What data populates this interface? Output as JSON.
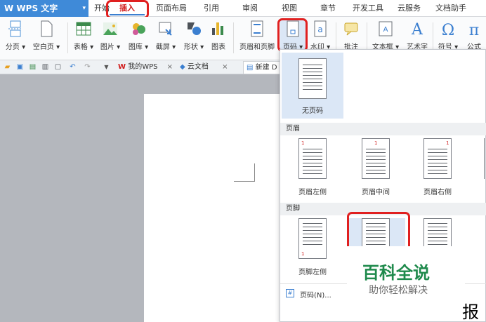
{
  "menubar": {
    "logo": "W WPS 文字",
    "tabs": [
      "开始",
      "插入",
      "页面布局",
      "引用",
      "审阅",
      "视图",
      "章节",
      "开发工具",
      "云服务",
      "文档助手"
    ]
  },
  "ribbon": {
    "buttons": [
      "分页",
      "空白页",
      "表格",
      "图片",
      "图库",
      "截屏",
      "形状",
      "图表",
      "页眉和页脚",
      "页码",
      "水印",
      "批注",
      "文本框",
      "艺术字",
      "符号",
      "公式"
    ]
  },
  "quickbar": {
    "tab_mywps": "我的WPS",
    "tab_cloud": "云文档",
    "tab_new": "新建 D"
  },
  "dropdown": {
    "no_page_number": "无页码",
    "header_section": "页眉",
    "header_items": [
      "页眉左侧",
      "页眉中间",
      "页眉右侧"
    ],
    "footer_section": "页脚",
    "footer_items": [
      "页脚左侧"
    ],
    "more": "页码(N)...",
    "num": "1"
  },
  "watermark": {
    "title": "百科全说",
    "subtitle": "助你轻松解决"
  },
  "bottom_char": "报",
  "colors": {
    "brand": "#3f8ad8",
    "highlight": "#e02020",
    "watermark_green": "#1f8a4c"
  }
}
